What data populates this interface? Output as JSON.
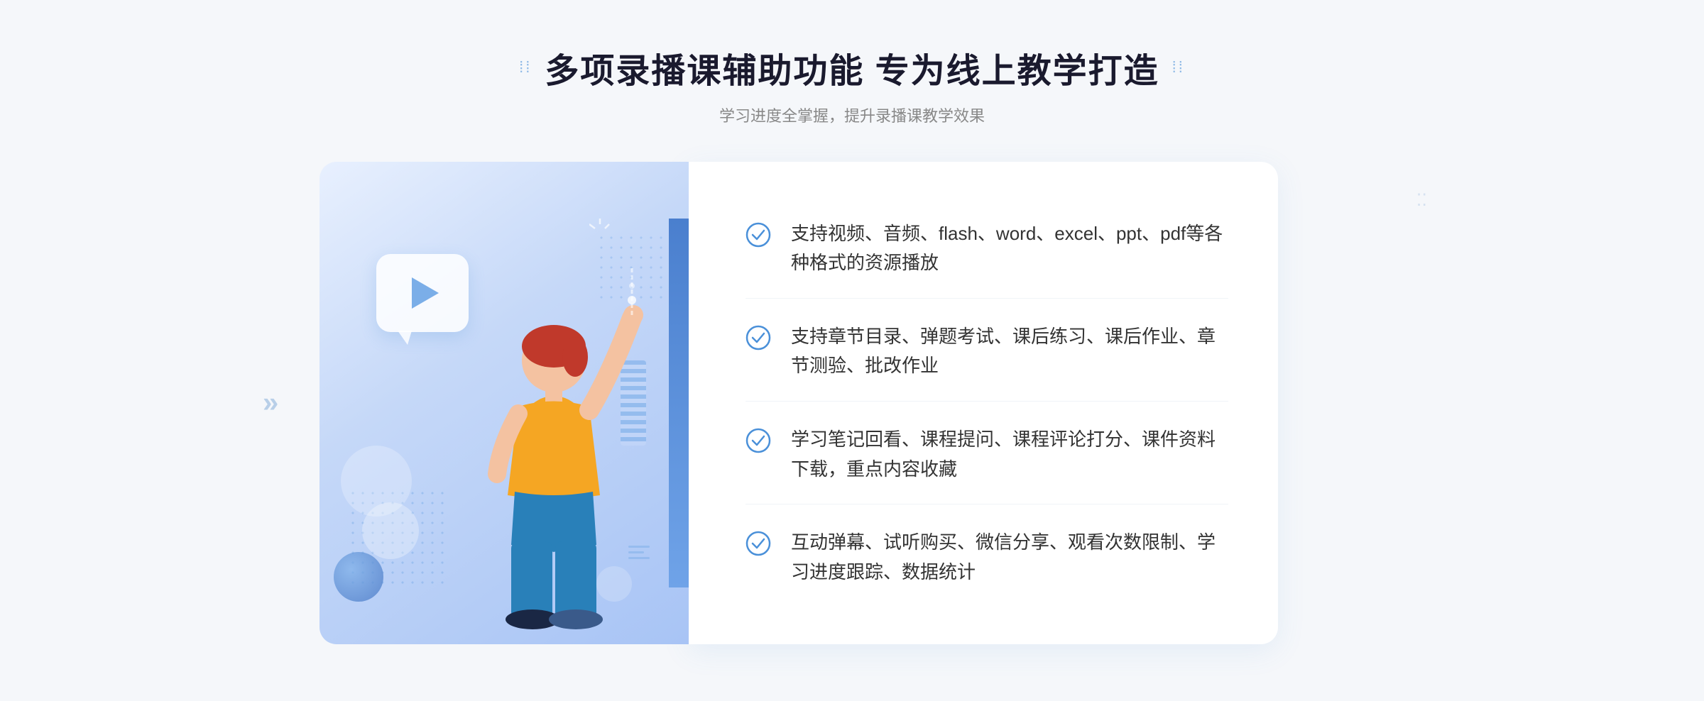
{
  "header": {
    "title": "多项录播课辅助功能 专为线上教学打造",
    "subtitle": "学习进度全掌握，提升录播课教学效果",
    "dots_left": "⁞⁞",
    "dots_right": "⁞⁞"
  },
  "features": [
    {
      "id": 1,
      "text": "支持视频、音频、flash、word、excel、ppt、pdf等各种格式的资源播放"
    },
    {
      "id": 2,
      "text": "支持章节目录、弹题考试、课后练习、课后作业、章节测验、批改作业"
    },
    {
      "id": 3,
      "text": "学习笔记回看、课程提问、课程评论打分、课件资料下载，重点内容收藏"
    },
    {
      "id": 4,
      "text": "互动弹幕、试听购买、微信分享、观看次数限制、学习进度跟踪、数据统计"
    }
  ],
  "colors": {
    "primary": "#4a7fce",
    "accent": "#6fa3e8",
    "text_dark": "#1a1a2e",
    "text_light": "#888888",
    "check_color": "#4a90d9"
  },
  "chevrons_left": "»",
  "illustration_alt": "教学功能插图"
}
